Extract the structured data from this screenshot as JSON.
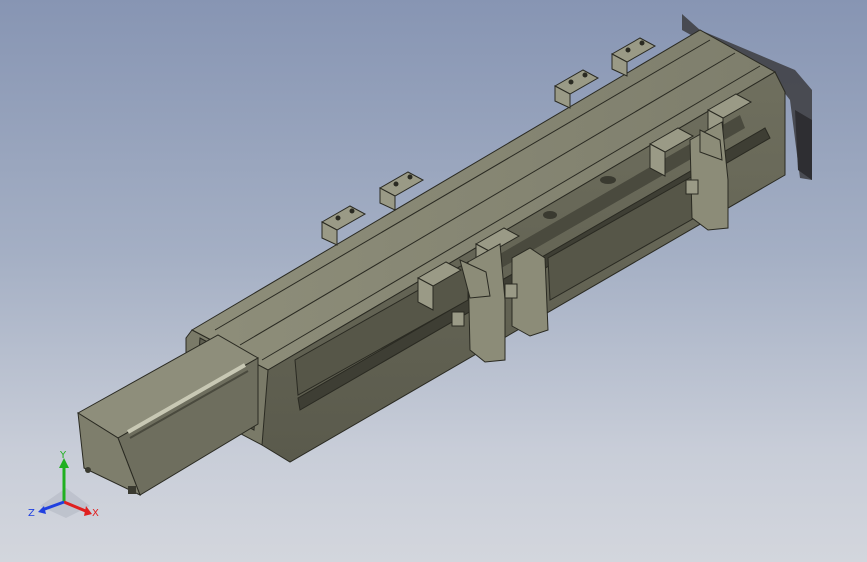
{
  "triad": {
    "x_label": "X",
    "y_label": "Y",
    "z_label": "Z",
    "colors": {
      "x": "#e02020",
      "y": "#20b020",
      "z": "#2040e0"
    }
  },
  "colors": {
    "background_top": "#8795b3",
    "background_bottom": "#d3d6dd",
    "body_top": "#8b8b77",
    "body_front": "#6a6a5a",
    "body_dark": "#56564a",
    "bracket": "#9a9a86",
    "motor_face": "#7c7c6c"
  }
}
